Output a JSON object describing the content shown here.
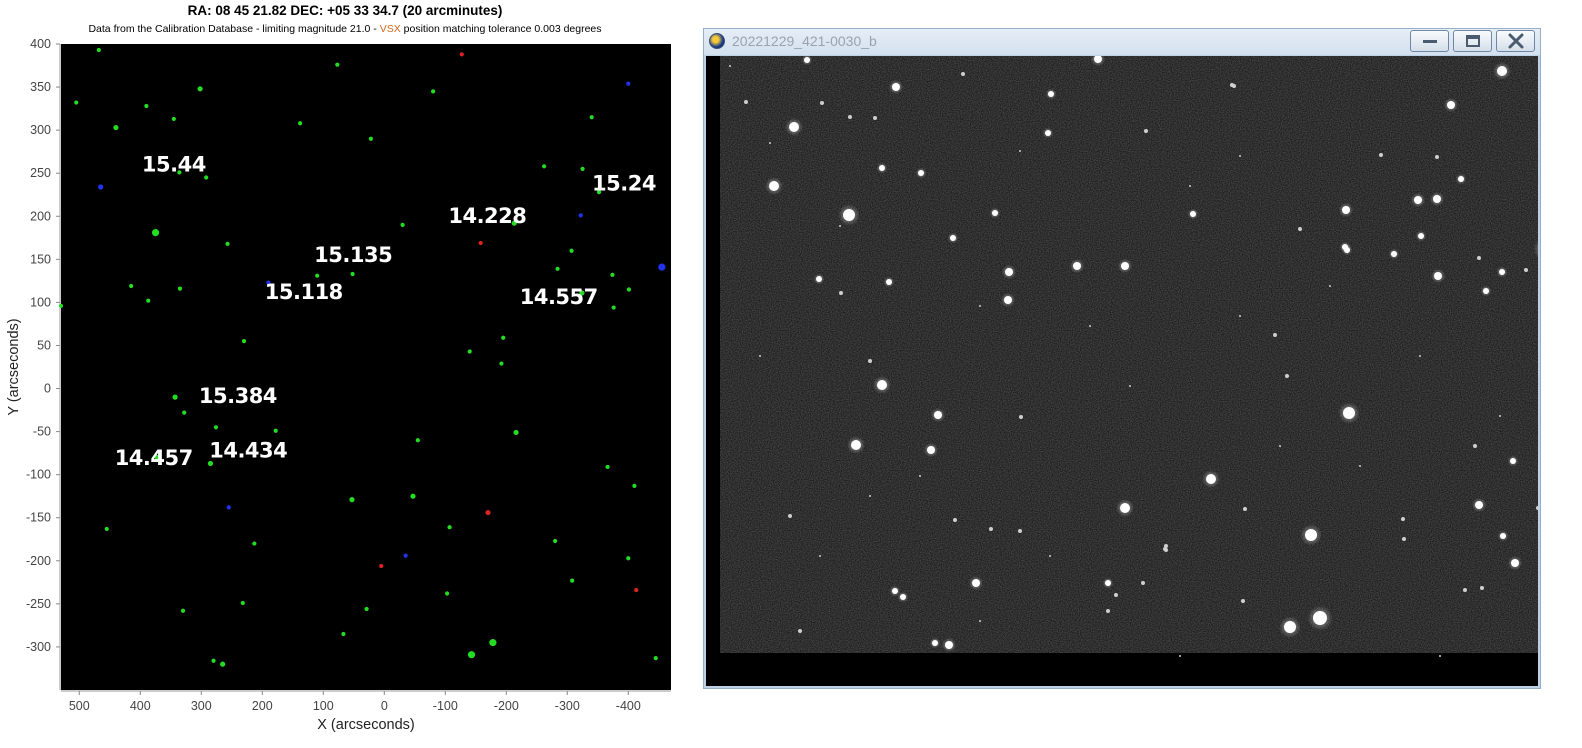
{
  "chart": {
    "title": "RA: 08 45 21.82  DEC: +05 33 34.7 (20 arcminutes)",
    "subtitle_main": "Data from the Calibration Database - limiting magnitude 21.0 - ",
    "subtitle_vsx": "VSX",
    "subtitle_tail": " position matching tolerance 0.003 degrees"
  },
  "chart_data": {
    "type": "scatter",
    "title": "RA: 08 45 21.82  DEC: +05 33 34.7 (20 arcminutes)",
    "xlabel": "X (arcseconds)",
    "ylabel": "Y (arcseconds)",
    "xlim": [
      530,
      -470
    ],
    "ylim": [
      -350,
      400
    ],
    "x_reversed": true,
    "grid": false,
    "background": "#000000",
    "xticks": [
      500,
      400,
      300,
      200,
      100,
      0,
      -100,
      -200,
      -300,
      -400
    ],
    "yticks": [
      400,
      350,
      300,
      250,
      200,
      150,
      100,
      50,
      0,
      -50,
      -100,
      -150,
      -200,
      -250,
      -300
    ],
    "colors": {
      "green": "#22dd22",
      "blue": "#2233ee",
      "red": "#dd2222"
    },
    "points": [
      {
        "x": 468,
        "y": 393,
        "size": 3,
        "color": "green"
      },
      {
        "x": 505,
        "y": 332,
        "size": 3,
        "color": "green"
      },
      {
        "x": 390,
        "y": 328,
        "size": 3,
        "color": "green"
      },
      {
        "x": 440,
        "y": 303,
        "size": 4,
        "color": "green"
      },
      {
        "x": 345,
        "y": 313,
        "size": 3,
        "color": "green"
      },
      {
        "x": 302,
        "y": 348,
        "size": 4,
        "color": "green"
      },
      {
        "x": 77,
        "y": 376,
        "size": 3,
        "color": "green"
      },
      {
        "x": 138,
        "y": 308,
        "size": 3,
        "color": "green"
      },
      {
        "x": 22,
        "y": 290,
        "size": 3,
        "color": "green"
      },
      {
        "x": -80,
        "y": 345,
        "size": 3,
        "color": "green"
      },
      {
        "x": 336,
        "y": 251,
        "size": 3,
        "color": "green"
      },
      {
        "x": 292,
        "y": 245,
        "size": 3,
        "color": "green"
      },
      {
        "x": 375,
        "y": 181,
        "size": 6,
        "color": "green"
      },
      {
        "x": 257,
        "y": 168,
        "size": 3,
        "color": "green"
      },
      {
        "x": 415,
        "y": 119,
        "size": 3,
        "color": "green"
      },
      {
        "x": 387,
        "y": 102,
        "size": 3,
        "color": "green"
      },
      {
        "x": 335,
        "y": 116,
        "size": 3,
        "color": "green"
      },
      {
        "x": 530,
        "y": 96,
        "size": 3,
        "color": "green"
      },
      {
        "x": 110,
        "y": 131,
        "size": 3,
        "color": "green"
      },
      {
        "x": 52,
        "y": 133,
        "size": 3,
        "color": "green"
      },
      {
        "x": -30,
        "y": 190,
        "size": 3,
        "color": "green"
      },
      {
        "x": -213,
        "y": 192,
        "size": 4,
        "color": "green"
      },
      {
        "x": -262,
        "y": 258,
        "size": 3,
        "color": "green"
      },
      {
        "x": -325,
        "y": 255,
        "size": 3,
        "color": "green"
      },
      {
        "x": -352,
        "y": 228,
        "size": 3,
        "color": "green"
      },
      {
        "x": -340,
        "y": 315,
        "size": 3,
        "color": "green"
      },
      {
        "x": -307,
        "y": 160,
        "size": 3,
        "color": "green"
      },
      {
        "x": -284,
        "y": 139,
        "size": 3,
        "color": "green"
      },
      {
        "x": -324,
        "y": 111,
        "size": 4,
        "color": "green"
      },
      {
        "x": -374,
        "y": 132,
        "size": 3,
        "color": "green"
      },
      {
        "x": -401,
        "y": 115,
        "size": 3,
        "color": "green"
      },
      {
        "x": -376,
        "y": 94,
        "size": 3,
        "color": "green"
      },
      {
        "x": 230,
        "y": 55,
        "size": 3,
        "color": "green"
      },
      {
        "x": -140,
        "y": 43,
        "size": 3,
        "color": "green"
      },
      {
        "x": -195,
        "y": 59,
        "size": 3,
        "color": "green"
      },
      {
        "x": -192,
        "y": 29,
        "size": 3,
        "color": "green"
      },
      {
        "x": 343,
        "y": -10,
        "size": 4,
        "color": "green"
      },
      {
        "x": 328,
        "y": -28,
        "size": 3,
        "color": "green"
      },
      {
        "x": 276,
        "y": -45,
        "size": 3,
        "color": "green"
      },
      {
        "x": 178,
        "y": -49,
        "size": 3,
        "color": "green"
      },
      {
        "x": -216,
        "y": -51,
        "size": 4,
        "color": "green"
      },
      {
        "x": -55,
        "y": -60,
        "size": 3,
        "color": "green"
      },
      {
        "x": 372,
        "y": -80,
        "size": 4,
        "color": "green"
      },
      {
        "x": 285,
        "y": -87,
        "size": 4,
        "color": "green"
      },
      {
        "x": -366,
        "y": -91,
        "size": 3,
        "color": "green"
      },
      {
        "x": -410,
        "y": -113,
        "size": 3,
        "color": "green"
      },
      {
        "x": 53,
        "y": -129,
        "size": 4,
        "color": "green"
      },
      {
        "x": -47,
        "y": -125,
        "size": 4,
        "color": "green"
      },
      {
        "x": -107,
        "y": -161,
        "size": 3,
        "color": "green"
      },
      {
        "x": 455,
        "y": -163,
        "size": 3,
        "color": "green"
      },
      {
        "x": 213,
        "y": -180,
        "size": 3,
        "color": "green"
      },
      {
        "x": -280,
        "y": -177,
        "size": 3,
        "color": "green"
      },
      {
        "x": -400,
        "y": -197,
        "size": 3,
        "color": "green"
      },
      {
        "x": -308,
        "y": -223,
        "size": 3,
        "color": "green"
      },
      {
        "x": -103,
        "y": -238,
        "size": 3,
        "color": "green"
      },
      {
        "x": 232,
        "y": -249,
        "size": 3,
        "color": "green"
      },
      {
        "x": 29,
        "y": -256,
        "size": 3,
        "color": "green"
      },
      {
        "x": 330,
        "y": -258,
        "size": 3,
        "color": "green"
      },
      {
        "x": 67,
        "y": -285,
        "size": 3,
        "color": "green"
      },
      {
        "x": -178,
        "y": -295,
        "size": 6,
        "color": "green"
      },
      {
        "x": -143,
        "y": -309,
        "size": 6,
        "color": "green"
      },
      {
        "x": 280,
        "y": -316,
        "size": 3,
        "color": "green"
      },
      {
        "x": 265,
        "y": -320,
        "size": 4,
        "color": "green"
      },
      {
        "x": -445,
        "y": -313,
        "size": 3,
        "color": "green"
      },
      {
        "x": 465,
        "y": 234,
        "size": 4,
        "color": "blue"
      },
      {
        "x": -400,
        "y": 354,
        "size": 3,
        "color": "blue"
      },
      {
        "x": -322,
        "y": 201,
        "size": 3,
        "color": "blue"
      },
      {
        "x": 190,
        "y": 123,
        "size": 3,
        "color": "blue"
      },
      {
        "x": -455,
        "y": 141,
        "size": 6,
        "color": "blue"
      },
      {
        "x": 255,
        "y": -138,
        "size": 3,
        "color": "blue"
      },
      {
        "x": -35,
        "y": -194,
        "size": 3,
        "color": "blue"
      },
      {
        "x": -127,
        "y": 388,
        "size": 3,
        "color": "red"
      },
      {
        "x": -158,
        "y": 169,
        "size": 3,
        "color": "red"
      },
      {
        "x": -170,
        "y": -144,
        "size": 4,
        "color": "red"
      },
      {
        "x": 5,
        "y": -206,
        "size": 3,
        "color": "red"
      },
      {
        "x": -413,
        "y": -234,
        "size": 3,
        "color": "red"
      }
    ],
    "annotations": [
      {
        "text": "15.44",
        "x": 345,
        "y": 252
      },
      {
        "text": "15.24",
        "x": -393,
        "y": 230
      },
      {
        "text": "14.228",
        "x": -169,
        "y": 192
      },
      {
        "text": "15.135",
        "x": 51,
        "y": 147
      },
      {
        "text": "15.118",
        "x": 132,
        "y": 104
      },
      {
        "text": "14.557",
        "x": -286,
        "y": 98
      },
      {
        "text": "15.384",
        "x": 240,
        "y": -17
      },
      {
        "text": "14.457",
        "x": 378,
        "y": -89
      },
      {
        "text": "14.434",
        "x": 223,
        "y": -80
      }
    ]
  },
  "image_window": {
    "title": "20221229_421-0030_b",
    "background": "#000000",
    "stars": [
      [
        87,
        4,
        3
      ],
      [
        378,
        3,
        4
      ],
      [
        243,
        18,
        2
      ],
      [
        512,
        29,
        2
      ],
      [
        514,
        30,
        2
      ],
      [
        782,
        15,
        5
      ],
      [
        26,
        46,
        2
      ],
      [
        176,
        31,
        4
      ],
      [
        102,
        47,
        2
      ],
      [
        331,
        38,
        3
      ],
      [
        731,
        49,
        4
      ],
      [
        74,
        71,
        5
      ],
      [
        130,
        61,
        2
      ],
      [
        155,
        62,
        2
      ],
      [
        328,
        77,
        3
      ],
      [
        426,
        75,
        2
      ],
      [
        661,
        99,
        2
      ],
      [
        717,
        101,
        2
      ],
      [
        162,
        112,
        3
      ],
      [
        201,
        117,
        3
      ],
      [
        741,
        123,
        3
      ],
      [
        54,
        130,
        5
      ],
      [
        717,
        143,
        4
      ],
      [
        129,
        159,
        6
      ],
      [
        275,
        157,
        3
      ],
      [
        473,
        158,
        3
      ],
      [
        626,
        154,
        4
      ],
      [
        698,
        144,
        4
      ],
      [
        580,
        173,
        2
      ],
      [
        233,
        182,
        3
      ],
      [
        625,
        191,
        3
      ],
      [
        701,
        180,
        3
      ],
      [
        627,
        194,
        3
      ],
      [
        674,
        198,
        3
      ],
      [
        826,
        193,
        7
      ],
      [
        759,
        202,
        2
      ],
      [
        806,
        214,
        2
      ],
      [
        289,
        216,
        4
      ],
      [
        357,
        210,
        4
      ],
      [
        405,
        210,
        4
      ],
      [
        718,
        220,
        4
      ],
      [
        782,
        216,
        3
      ],
      [
        99,
        223,
        3
      ],
      [
        169,
        226,
        3
      ],
      [
        121,
        237,
        2
      ],
      [
        288,
        244,
        4
      ],
      [
        766,
        235,
        3
      ],
      [
        555,
        279,
        2
      ],
      [
        567,
        320,
        2
      ],
      [
        150,
        305,
        2
      ],
      [
        162,
        329,
        5
      ],
      [
        629,
        357,
        6
      ],
      [
        218,
        359,
        4
      ],
      [
        301,
        361,
        2
      ],
      [
        136,
        389,
        5
      ],
      [
        211,
        394,
        4
      ],
      [
        755,
        390,
        2
      ],
      [
        793,
        405,
        3
      ],
      [
        491,
        423,
        5
      ],
      [
        405,
        452,
        5
      ],
      [
        591,
        479,
        6
      ],
      [
        235,
        464,
        2
      ],
      [
        70,
        460,
        2
      ],
      [
        525,
        453,
        2
      ],
      [
        759,
        449,
        4
      ],
      [
        683,
        463,
        2
      ],
      [
        818,
        452,
        2
      ],
      [
        271,
        473,
        2
      ],
      [
        300,
        475,
        2
      ],
      [
        446,
        494,
        2
      ],
      [
        445,
        493,
        2
      ],
      [
        684,
        483,
        2
      ],
      [
        783,
        480,
        3
      ],
      [
        446,
        490,
        2
      ],
      [
        795,
        507,
        4
      ],
      [
        256,
        527,
        4
      ],
      [
        175,
        535,
        3
      ],
      [
        183,
        541,
        3
      ],
      [
        423,
        527,
        2
      ],
      [
        388,
        527,
        3
      ],
      [
        396,
        539,
        2
      ],
      [
        570,
        571,
        6
      ],
      [
        600,
        562,
        7
      ],
      [
        215,
        587,
        3
      ],
      [
        229,
        589,
        4
      ],
      [
        80,
        575,
        2
      ],
      [
        388,
        555,
        2
      ],
      [
        523,
        545,
        2
      ],
      [
        745,
        534,
        2
      ],
      [
        762,
        532,
        2
      ],
      [
        10,
        10,
        1
      ],
      [
        50,
        87,
        1
      ],
      [
        120,
        170,
        1
      ],
      [
        300,
        95,
        1
      ],
      [
        470,
        130,
        1
      ],
      [
        520,
        100,
        1
      ],
      [
        610,
        230,
        1
      ],
      [
        700,
        300,
        1
      ],
      [
        260,
        250,
        1
      ],
      [
        370,
        270,
        1
      ],
      [
        410,
        330,
        1
      ],
      [
        560,
        390,
        1
      ],
      [
        640,
        410,
        1
      ],
      [
        200,
        420,
        1
      ],
      [
        100,
        500,
        1
      ],
      [
        330,
        500,
        1
      ],
      [
        460,
        600,
        1
      ],
      [
        720,
        600,
        1
      ],
      [
        40,
        300,
        1
      ],
      [
        780,
        360,
        1
      ],
      [
        520,
        260,
        1
      ],
      [
        150,
        440,
        1
      ],
      [
        260,
        565,
        1
      ]
    ]
  }
}
